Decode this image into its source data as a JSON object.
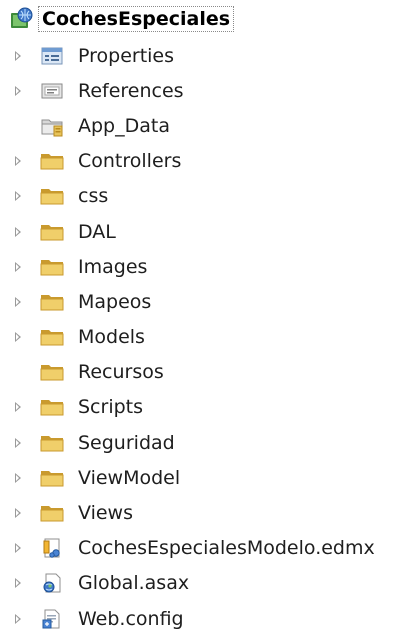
{
  "solution_explorer": {
    "project": {
      "label": "CochesEspeciales",
      "icon": "web-project-icon"
    },
    "items": [
      {
        "label": "Properties",
        "icon": "properties-icon",
        "expandable": true
      },
      {
        "label": "References",
        "icon": "references-icon",
        "expandable": true
      },
      {
        "label": "App_Data",
        "icon": "special-folder-icon",
        "expandable": false
      },
      {
        "label": "Controllers",
        "icon": "folder-icon",
        "expandable": true
      },
      {
        "label": "css",
        "icon": "folder-icon",
        "expandable": true
      },
      {
        "label": "DAL",
        "icon": "folder-icon",
        "expandable": true
      },
      {
        "label": "Images",
        "icon": "folder-icon",
        "expandable": true
      },
      {
        "label": "Mapeos",
        "icon": "folder-icon",
        "expandable": true
      },
      {
        "label": "Models",
        "icon": "folder-icon",
        "expandable": true
      },
      {
        "label": "Recursos",
        "icon": "folder-icon",
        "expandable": false
      },
      {
        "label": "Scripts",
        "icon": "folder-icon",
        "expandable": true
      },
      {
        "label": "Seguridad",
        "icon": "folder-icon",
        "expandable": true
      },
      {
        "label": "ViewModel",
        "icon": "folder-icon",
        "expandable": true
      },
      {
        "label": "Views",
        "icon": "folder-icon",
        "expandable": true
      },
      {
        "label": "CochesEspecialesModelo.edmx",
        "icon": "edmx-file-icon",
        "expandable": true
      },
      {
        "label": "Global.asax",
        "icon": "global-asax-icon",
        "expandable": true
      },
      {
        "label": "Web.config",
        "icon": "config-file-icon",
        "expandable": true
      }
    ]
  },
  "colors": {
    "folder": "#e8c45a",
    "folder_dark": "#c99a2e",
    "expander": "#9a9a9a",
    "text": "#1e1e1e"
  }
}
